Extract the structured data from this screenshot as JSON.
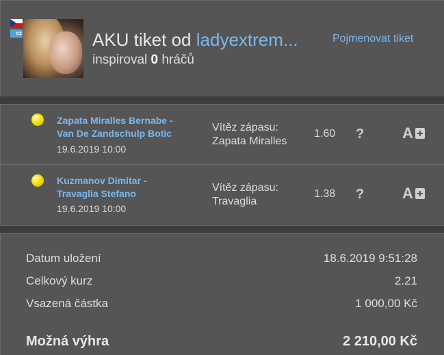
{
  "header": {
    "title_prefix": "AKU tiket od",
    "username": "ladyextrem...",
    "rename_link": "Pojmenovat tiket",
    "inspired_prefix": "inspiroval",
    "inspired_count": "0",
    "inspired_suffix": "hráčů",
    "country_badge": "cz"
  },
  "matches": [
    {
      "teams_line1": "Zapata Miralles Bernabe -",
      "teams_line2": "Van De Zandschulp Botic",
      "date": "19.6.2019 10:00",
      "bet_type": "Vítěz zápasu:",
      "bet_pick": "Zapata Miralles",
      "odds": "1.60",
      "status": "?"
    },
    {
      "teams_line1": "Kuzmanov Dimitar -",
      "teams_line2": "Travaglia Stefano",
      "date": "19.6.2019 10:00",
      "bet_type": "Vítěz zápasu:",
      "bet_pick": "Travaglia",
      "odds": "1.38",
      "status": "?"
    }
  ],
  "summary": {
    "saved_label": "Datum uložení",
    "saved_value": "18.6.2019 9:51:28",
    "total_odds_label": "Celkový kurz",
    "total_odds_value": "2.21",
    "stake_label": "Vsazená částka",
    "stake_value": "1 000,00 Kč",
    "win_label": "Možná výhra",
    "win_value": "2 210,00 Kč"
  },
  "colors": {
    "accent_link": "#7ab8ee",
    "panel_bg": "#555555",
    "page_bg": "#3d3d3d"
  },
  "icons": [
    "czech-flag-icon",
    "tennis-ball-icon",
    "question-icon",
    "add-to-ticket-icon"
  ]
}
